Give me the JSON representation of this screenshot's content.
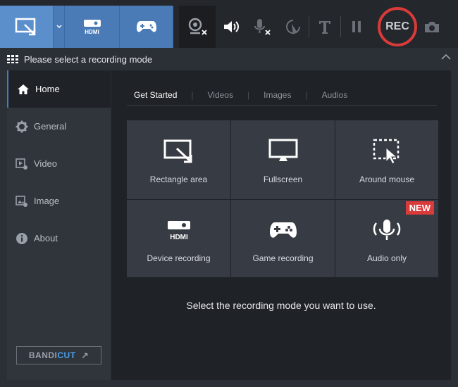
{
  "toolbar": {
    "buttons": [
      "rectangle-mode",
      "hdmi-mode",
      "game-mode",
      "webcam",
      "speaker",
      "microphone",
      "cursor",
      "text",
      "pause"
    ],
    "hdmi_label": "HDMI",
    "rec_label": "REC"
  },
  "modebar": {
    "title": "Please select a recording mode"
  },
  "sidebar": {
    "items": [
      {
        "label": "Home",
        "icon": "home-icon"
      },
      {
        "label": "General",
        "icon": "gear-icon"
      },
      {
        "label": "Video",
        "icon": "video-icon"
      },
      {
        "label": "Image",
        "icon": "image-icon"
      },
      {
        "label": "About",
        "icon": "info-icon"
      }
    ],
    "brand_a": "BANDI",
    "brand_b": "CUT",
    "brand_arrow": "↗"
  },
  "tabs": [
    {
      "label": "Get Started"
    },
    {
      "label": "Videos"
    },
    {
      "label": "Images"
    },
    {
      "label": "Audios"
    }
  ],
  "modes": [
    {
      "label": "Rectangle area"
    },
    {
      "label": "Fullscreen"
    },
    {
      "label": "Around mouse"
    },
    {
      "label": "Device recording"
    },
    {
      "label": "Game recording"
    },
    {
      "label": "Audio only",
      "badge": "NEW"
    }
  ],
  "hint": "Select the recording mode you want to use.",
  "colors": {
    "accent": "#4a7bb7",
    "rec": "#d93a3a",
    "new_badge": "#d93a3a"
  }
}
